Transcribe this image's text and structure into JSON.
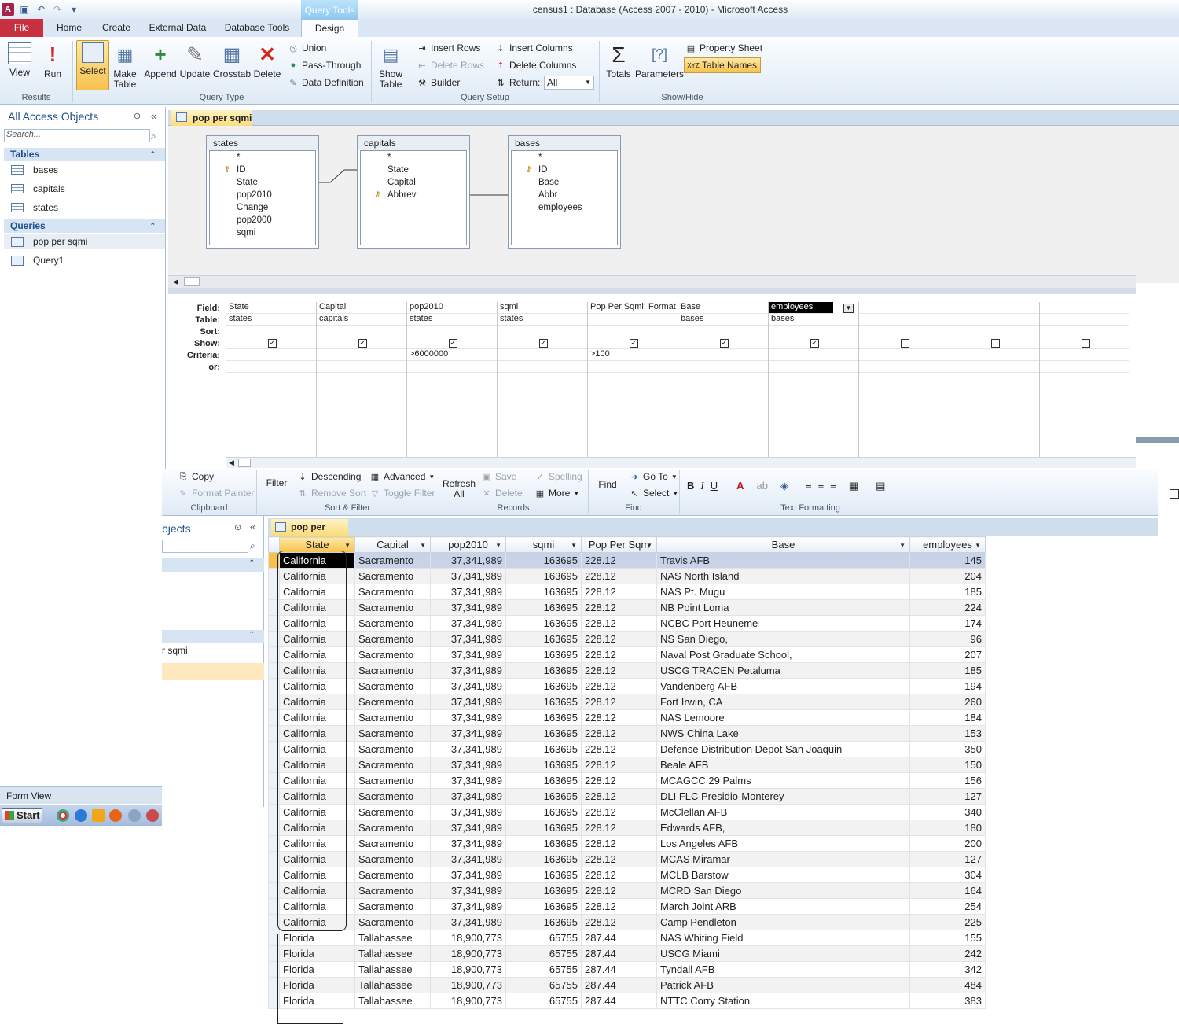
{
  "window": {
    "title": "census1 : Database (Access 2007 - 2010) -  Microsoft Access",
    "context_label": "Query Tools"
  },
  "tabs": {
    "file": "File",
    "home": "Home",
    "create": "Create",
    "external": "External Data",
    "dbtools": "Database Tools",
    "design": "Design"
  },
  "ribbon": {
    "results": {
      "label": "Results",
      "view": "View",
      "run": "Run"
    },
    "query_type": {
      "label": "Query Type",
      "select": "Select",
      "make_table": "Make\nTable",
      "make_table_1": "Make",
      "make_table_2": "Table",
      "append": "Append",
      "update": "Update",
      "crosstab": "Crosstab",
      "delete": "Delete",
      "union": "Union",
      "pass_through": "Pass-Through",
      "data_definition": "Data Definition"
    },
    "query_setup": {
      "label": "Query Setup",
      "show_table_1": "Show",
      "show_table_2": "Table",
      "insert_rows": "Insert Rows",
      "delete_rows": "Delete Rows",
      "builder": "Builder",
      "insert_columns": "Insert Columns",
      "delete_columns": "Delete Columns",
      "return_label": "Return:",
      "return_value": "All"
    },
    "show_hide": {
      "label": "Show/Hide",
      "totals": "Totals",
      "parameters": "Parameters",
      "property_sheet": "Property Sheet",
      "table_names": "Table Names"
    }
  },
  "nav": {
    "header": "All Access Objects",
    "search_placeholder": "Search...",
    "tables_header": "Tables",
    "tables": [
      "bases",
      "capitals",
      "states"
    ],
    "queries_header": "Queries",
    "queries": [
      "pop per sqmi",
      "Query1"
    ]
  },
  "doc_tab": "pop per sqmi",
  "field_lists": [
    {
      "name": "states",
      "fields": [
        "*",
        "ID",
        "State",
        "pop2010",
        "Change",
        "pop2000",
        "sqmi"
      ]
    },
    {
      "name": "capitals",
      "fields": [
        "*",
        "State",
        "Capital",
        "Abbrev"
      ]
    },
    {
      "name": "bases",
      "fields": [
        "*",
        "ID",
        "Base",
        "Abbr",
        "employees"
      ]
    }
  ],
  "qbe": {
    "row_labels": [
      "Field:",
      "Table:",
      "Sort:",
      "Show:",
      "Criteria:",
      "or:"
    ],
    "columns": [
      {
        "field": "State",
        "table": "states",
        "show": true,
        "criteria": ""
      },
      {
        "field": "Capital",
        "table": "capitals",
        "show": true,
        "criteria": ""
      },
      {
        "field": "pop2010",
        "table": "states",
        "show": true,
        "criteria": ">6000000"
      },
      {
        "field": "sqmi",
        "table": "states",
        "show": true,
        "criteria": ""
      },
      {
        "field": "Pop Per Sqmi: Format",
        "table": "",
        "show": true,
        "criteria": ">100"
      },
      {
        "field": "Base",
        "table": "bases",
        "show": true,
        "criteria": ""
      },
      {
        "field": "employees",
        "table": "bases",
        "show": true,
        "criteria": ""
      },
      {
        "field": "",
        "table": "",
        "show": false,
        "criteria": ""
      },
      {
        "field": "",
        "table": "",
        "show": false,
        "criteria": ""
      },
      {
        "field": "",
        "table": "",
        "show": false,
        "criteria": ""
      }
    ]
  },
  "home_ribbon": {
    "copy": "Copy",
    "format_painter": "Format Painter",
    "clipboard": "Clipboard",
    "filter": "Filter",
    "descending": "Descending",
    "remove_sort": "Remove Sort",
    "advanced": "Advanced",
    "toggle_filter": "Toggle Filter",
    "sort_filter": "Sort & Filter",
    "refresh_1": "Refresh",
    "refresh_2": "All",
    "save": "Save",
    "delete": "Delete",
    "spelling": "Spelling",
    "more": "More",
    "records": "Records",
    "find": "Find",
    "goto": "Go To",
    "select": "Select",
    "find_group": "Find",
    "text_formatting": "Text Formatting"
  },
  "overlay_nav": {
    "header": "bjects",
    "item": "r sqmi"
  },
  "datasheet": {
    "tab": "pop per sqmi",
    "headers": [
      "State",
      "Capital",
      "pop2010",
      "sqmi",
      "Pop Per Sqm",
      "Base",
      "employees"
    ],
    "rows": [
      [
        "California",
        "Sacramento",
        "37,341,989",
        "163695",
        "228.12",
        "Travis AFB",
        "145"
      ],
      [
        "California",
        "Sacramento",
        "37,341,989",
        "163695",
        "228.12",
        "NAS North Island",
        "204"
      ],
      [
        "California",
        "Sacramento",
        "37,341,989",
        "163695",
        "228.12",
        "NAS Pt. Mugu",
        "185"
      ],
      [
        "California",
        "Sacramento",
        "37,341,989",
        "163695",
        "228.12",
        "NB Point Loma",
        "224"
      ],
      [
        "California",
        "Sacramento",
        "37,341,989",
        "163695",
        "228.12",
        "NCBC Port Heuneme",
        "174"
      ],
      [
        "California",
        "Sacramento",
        "37,341,989",
        "163695",
        "228.12",
        "NS San Diego,",
        "96"
      ],
      [
        "California",
        "Sacramento",
        "37,341,989",
        "163695",
        "228.12",
        "Naval Post Graduate School,",
        "207"
      ],
      [
        "California",
        "Sacramento",
        "37,341,989",
        "163695",
        "228.12",
        "USCG TRACEN Petaluma",
        "185"
      ],
      [
        "California",
        "Sacramento",
        "37,341,989",
        "163695",
        "228.12",
        "Vandenberg AFB",
        "194"
      ],
      [
        "California",
        "Sacramento",
        "37,341,989",
        "163695",
        "228.12",
        "Fort Irwin, CA",
        "260"
      ],
      [
        "California",
        "Sacramento",
        "37,341,989",
        "163695",
        "228.12",
        "NAS Lemoore",
        "184"
      ],
      [
        "California",
        "Sacramento",
        "37,341,989",
        "163695",
        "228.12",
        "NWS China Lake",
        "153"
      ],
      [
        "California",
        "Sacramento",
        "37,341,989",
        "163695",
        "228.12",
        "Defense Distribution Depot San Joaquin",
        "350"
      ],
      [
        "California",
        "Sacramento",
        "37,341,989",
        "163695",
        "228.12",
        "Beale AFB",
        "150"
      ],
      [
        "California",
        "Sacramento",
        "37,341,989",
        "163695",
        "228.12",
        "MCAGCC 29 Palms",
        "156"
      ],
      [
        "California",
        "Sacramento",
        "37,341,989",
        "163695",
        "228.12",
        "DLI FLC Presidio-Monterey",
        "127"
      ],
      [
        "California",
        "Sacramento",
        "37,341,989",
        "163695",
        "228.12",
        "McClellan AFB",
        "340"
      ],
      [
        "California",
        "Sacramento",
        "37,341,989",
        "163695",
        "228.12",
        "Edwards AFB,",
        "180"
      ],
      [
        "California",
        "Sacramento",
        "37,341,989",
        "163695",
        "228.12",
        "Los Angeles AFB",
        "200"
      ],
      [
        "California",
        "Sacramento",
        "37,341,989",
        "163695",
        "228.12",
        "MCAS Miramar",
        "127"
      ],
      [
        "California",
        "Sacramento",
        "37,341,989",
        "163695",
        "228.12",
        "MCLB Barstow",
        "304"
      ],
      [
        "California",
        "Sacramento",
        "37,341,989",
        "163695",
        "228.12",
        "MCRD San Diego",
        "164"
      ],
      [
        "California",
        "Sacramento",
        "37,341,989",
        "163695",
        "228.12",
        "March Joint ARB",
        "254"
      ],
      [
        "California",
        "Sacramento",
        "37,341,989",
        "163695",
        "228.12",
        "Camp Pendleton",
        "225"
      ],
      [
        "Florida",
        "Tallahassee",
        "18,900,773",
        "65755",
        "287.44",
        "NAS Whiting Field",
        "155"
      ],
      [
        "Florida",
        "Tallahassee",
        "18,900,773",
        "65755",
        "287.44",
        "USCG Miami",
        "242"
      ],
      [
        "Florida",
        "Tallahassee",
        "18,900,773",
        "65755",
        "287.44",
        "Tyndall AFB",
        "342"
      ],
      [
        "Florida",
        "Tallahassee",
        "18,900,773",
        "65755",
        "287.44",
        "Patrick AFB",
        "484"
      ],
      [
        "Florida",
        "Tallahassee",
        "18,900,773",
        "65755",
        "287.44",
        "NTTC Corry Station",
        "383"
      ]
    ]
  },
  "statusbar": "Form View",
  "taskbar": {
    "start": "Start"
  }
}
